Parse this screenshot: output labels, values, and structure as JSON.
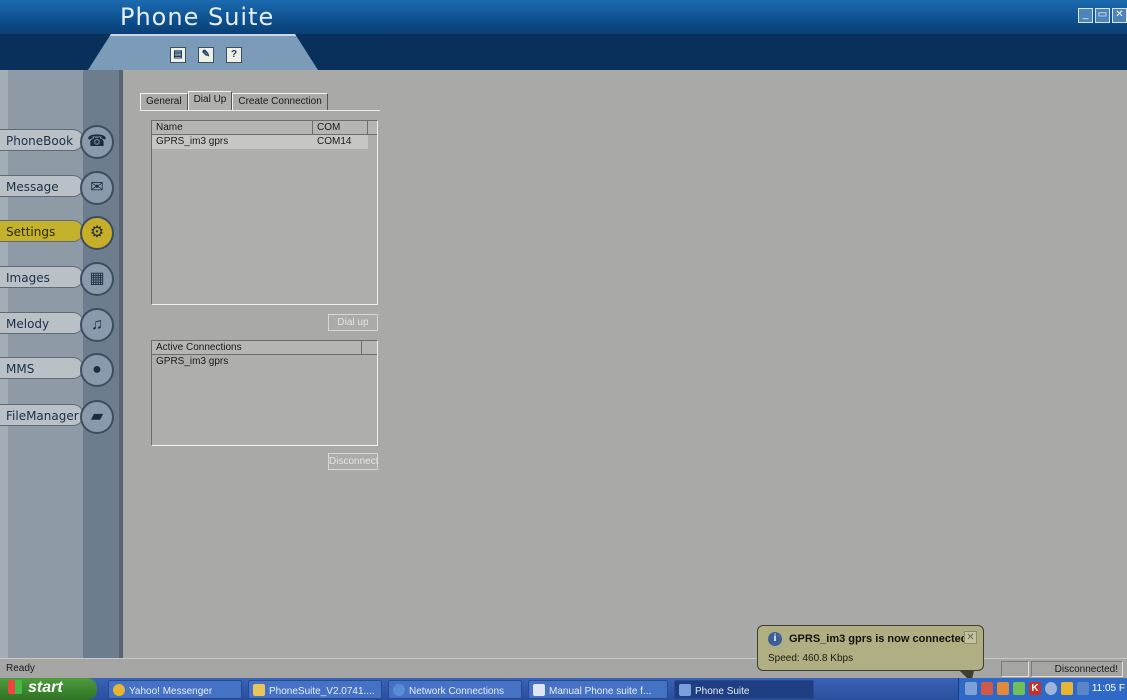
{
  "window": {
    "title": "Phone Suite",
    "controls": [
      "_",
      "▭",
      "✕"
    ]
  },
  "toolbar": {
    "buttons": [
      {
        "name": "properties",
        "glyph": "▤"
      },
      {
        "name": "edit",
        "glyph": "✎"
      },
      {
        "name": "help",
        "glyph": "?"
      }
    ]
  },
  "nav": {
    "items": [
      {
        "label": "PhoneBook",
        "icon": "phone-icon",
        "glyph": "☎"
      },
      {
        "label": "Message",
        "icon": "envelope-icon",
        "glyph": "✉"
      },
      {
        "label": "Settings",
        "icon": "settings-icon",
        "glyph": "⚙",
        "active": true
      },
      {
        "label": "Images",
        "icon": "images-icon",
        "glyph": "▦"
      },
      {
        "label": "Melody",
        "icon": "music-icon",
        "glyph": "♫"
      },
      {
        "label": "MMS",
        "icon": "balloon-icon",
        "glyph": "●"
      },
      {
        "label": "FileManager",
        "icon": "folder-icon",
        "glyph": "▰"
      }
    ]
  },
  "tabs": [
    {
      "label": "General"
    },
    {
      "label": "Dial Up",
      "active": true
    },
    {
      "label": "Create Connection"
    }
  ],
  "dialup": {
    "columns": [
      "Name",
      "COM"
    ],
    "rows": [
      {
        "name": "GPRS_im3 gprs",
        "com": "COM14"
      }
    ],
    "dial_button": "Dial up"
  },
  "active_connections": {
    "header": "Active Connections",
    "rows": [
      "GPRS_im3 gprs"
    ],
    "disconnect_button": "Disconnect"
  },
  "status": {
    "left": "Ready",
    "right": "Disconnected!"
  },
  "balloon": {
    "title": "GPRS_im3 gprs is now connected",
    "text": "Speed: 460.8 Kbps",
    "close": "✕",
    "info": "i"
  },
  "taskbar": {
    "start": "start",
    "tasks": [
      {
        "label": "Yahoo! Messenger",
        "color": "#e7b531"
      },
      {
        "label": "PhoneSuite_V2.0741....",
        "color": "#e7c55a"
      },
      {
        "label": "Network Connections",
        "color": "#5a8bd6"
      },
      {
        "label": "Manual Phone suite f...",
        "color": "#dfe6f3"
      },
      {
        "label": "Phone Suite",
        "color": "#7a9fd9",
        "active": true
      }
    ],
    "clock": "11:05 F"
  }
}
